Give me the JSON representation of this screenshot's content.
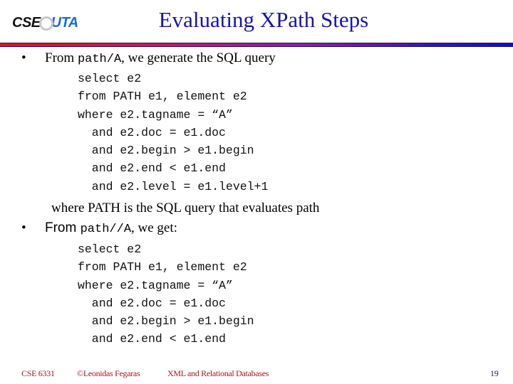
{
  "logo": {
    "part1": "CSE",
    "part2": "UTA"
  },
  "title": "Evaluating XPath Steps",
  "bullets": [
    {
      "marker": "•",
      "lead": "From ",
      "code": "path/A",
      "rest": ", we generate the SQL query"
    },
    {
      "marker": "•",
      "lead": "From ",
      "code": "path//A",
      "rest": ", we get:"
    }
  ],
  "query1": [
    "select e2",
    "from PATH e1, element e2",
    "where e2.tagname = “A”",
    "  and e2.doc = e1.doc",
    "  and e2.begin > e1.begin",
    "  and e2.end < e1.end",
    "  and e2.level = e1.level+1"
  ],
  "note": "where PATH is the SQL query that evaluates path",
  "query2": [
    "select e2",
    "from PATH e1, element e2",
    "where e2.tagname = “A”",
    "  and e2.doc = e1.doc",
    "  and e2.begin > e1.begin",
    "  and e2.end < e1.end"
  ],
  "footer": {
    "course": "CSE 6331",
    "author": "©Leonidas Fegaras",
    "subject": "XML and Relational Databases",
    "page": "19"
  },
  "colors": {
    "title": "#1616a6",
    "footer": "#a01822",
    "page_number": "#1a1a6a",
    "rule_start": "#e8101c",
    "rule_end": "#0a0ae8"
  }
}
